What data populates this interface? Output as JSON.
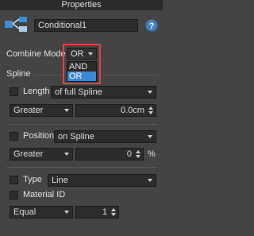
{
  "window": {
    "title": "Properties"
  },
  "header": {
    "name_value": "Conditional1",
    "icon": "conditional-object-icon",
    "help_icon": "help-icon"
  },
  "combine": {
    "label": "Combine Mode",
    "selected": "OR",
    "options": [
      "AND",
      "OR"
    ],
    "highlight_color": "#e84040"
  },
  "spline": {
    "group_label": "Spline",
    "length": {
      "label": "Length",
      "mode": "of full Spline",
      "compare": "Greater",
      "value": "0.0cm"
    },
    "position": {
      "label": "Position",
      "mode": "on Spline",
      "compare": "Greater",
      "value": "0",
      "unit": "%"
    },
    "type": {
      "label": "Type",
      "value": "Line"
    },
    "material": {
      "label": "Material ID",
      "compare": "Equal",
      "value": "1"
    }
  }
}
